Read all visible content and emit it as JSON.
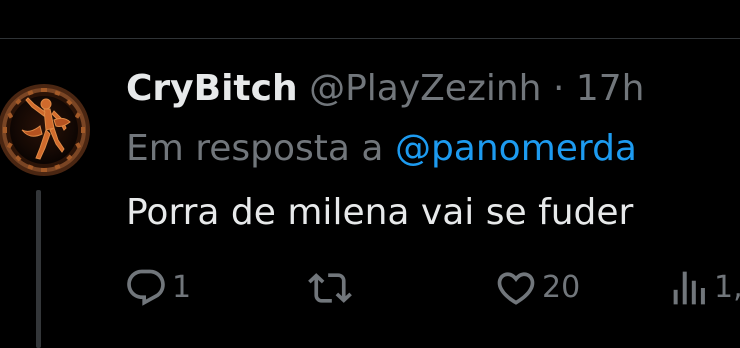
{
  "tweet": {
    "display_name": "CryBitch",
    "handle": "@PlayZezinh",
    "separator": "·",
    "time": "17h",
    "reply_prefix": "Em resposta a",
    "reply_to": "@panomerda",
    "text": "Porra de milena vai se fuder"
  },
  "actions": {
    "reply_count": "1",
    "retweet_count": "",
    "like_count": "20",
    "views_count": "1,"
  },
  "icons": {
    "reply": "reply-icon",
    "retweet": "retweet-icon",
    "like": "heart-icon",
    "views": "views-icon"
  },
  "colors": {
    "background": "#000000",
    "text": "#e7e9ea",
    "muted": "#71767b",
    "link": "#1d9bf0",
    "divider": "#2f3336"
  }
}
